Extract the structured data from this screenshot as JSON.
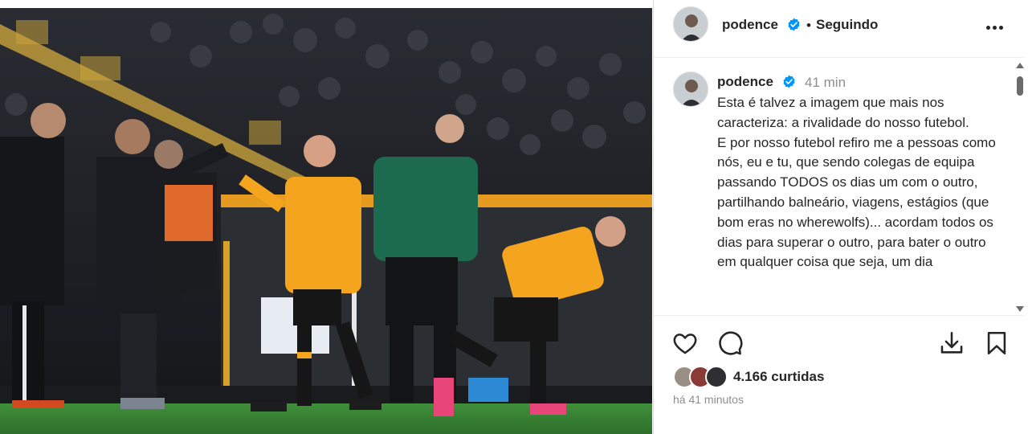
{
  "post": {
    "photo_alt": "",
    "author": {
      "username": "podence",
      "verified": true,
      "follow_status": "Seguindo"
    },
    "caption": {
      "username": "podence",
      "time_ago": "41 min",
      "text": "Esta é talvez a imagem que mais nos caracteriza: a rivalidade do nosso futebol.\nE por nosso futebol refiro me a pessoas como nós, eu e tu, que sendo colegas de equipa passando TODOS os dias um com o outro, partilhando balneário, viagens, estágios (que bom eras no wherewolfs)... acordam todos os dias para superar o outro, para bater o outro em qualquer coisa que seja, um dia"
    },
    "likes_label": "4.166 curtidas",
    "timestamp_label": "há 41 minutos"
  },
  "icons": {
    "more": "more-options-icon",
    "verified": "verified-badge-icon",
    "like": "heart-icon",
    "comment": "comment-icon",
    "download": "download-icon",
    "save": "bookmark-icon"
  },
  "colors": {
    "verified_blue": "#0095f6",
    "text": "#262626",
    "secondary_text": "#8e8e8e",
    "wolves_orange": "#f4a41d"
  }
}
